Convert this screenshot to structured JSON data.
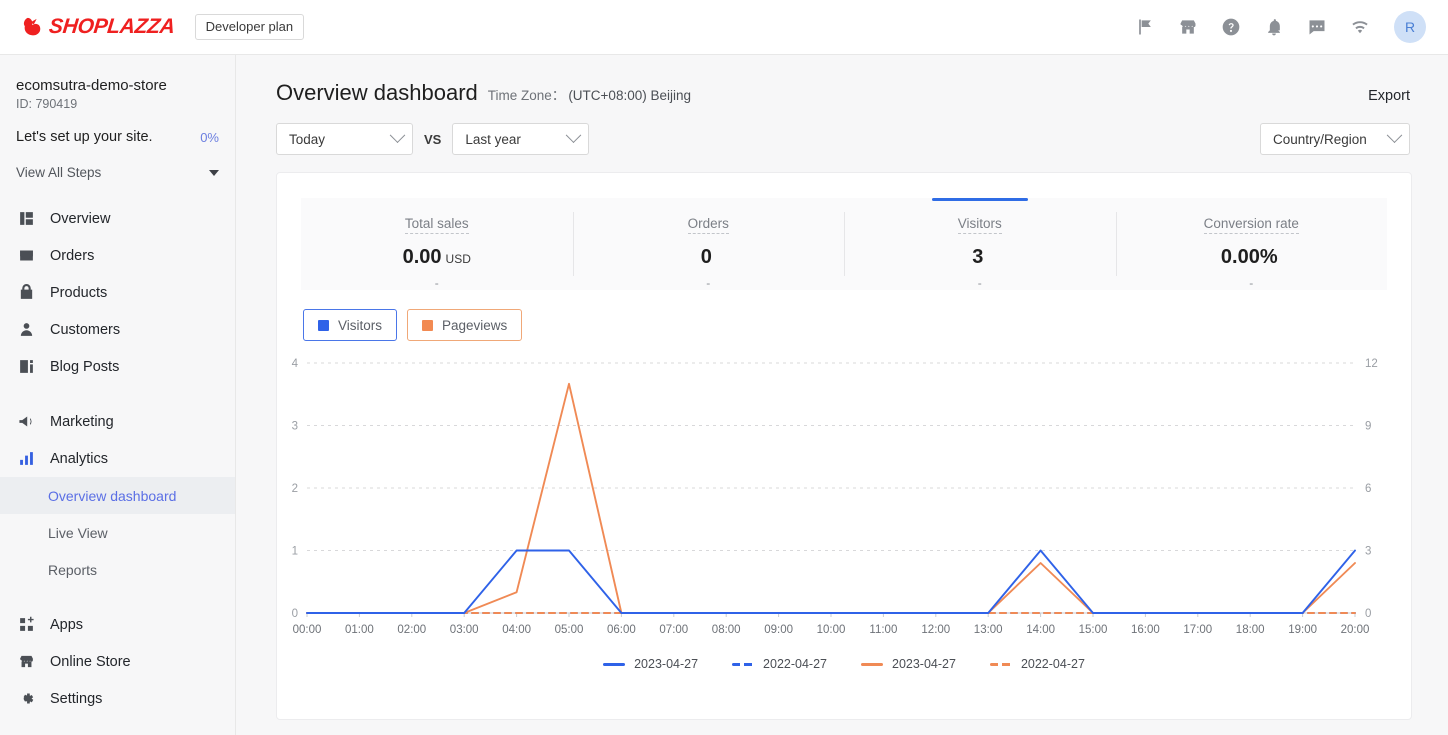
{
  "topbar": {
    "brand": "SHOPLAZZA",
    "plan_badge": "Developer plan",
    "icons": [
      "flag-icon",
      "store-icon",
      "help-icon",
      "bell-icon",
      "chat-icon",
      "wifi-icon"
    ],
    "avatar_initial": "R"
  },
  "sidebar": {
    "store_name": "ecomsutra-demo-store",
    "store_id": "ID: 790419",
    "setup_text": "Let's set up your site.",
    "setup_percent": "0%",
    "view_all_steps": "View All Steps",
    "nav_primary": [
      {
        "label": "Overview",
        "icon": "overview-icon"
      },
      {
        "label": "Orders",
        "icon": "orders-icon"
      },
      {
        "label": "Products",
        "icon": "products-icon"
      },
      {
        "label": "Customers",
        "icon": "customers-icon"
      },
      {
        "label": "Blog Posts",
        "icon": "blog-posts-icon"
      }
    ],
    "nav_secondary": [
      {
        "label": "Marketing",
        "icon": "marketing-icon"
      },
      {
        "label": "Analytics",
        "icon": "analytics-icon"
      }
    ],
    "nav_sub": [
      {
        "label": "Overview dashboard",
        "active": true
      },
      {
        "label": "Live View",
        "active": false
      },
      {
        "label": "Reports",
        "active": false
      }
    ],
    "nav_tertiary": [
      {
        "label": "Apps",
        "icon": "apps-icon"
      },
      {
        "label": "Online Store",
        "icon": "online-store-icon"
      },
      {
        "label": "Settings",
        "icon": "settings-icon"
      }
    ]
  },
  "header": {
    "title": "Overview dashboard",
    "timezone_label": "Time Zone：",
    "timezone_value": "(UTC+08:00) Beijing",
    "export_label": "Export"
  },
  "filters": {
    "range_primary": "Today",
    "vs_label": "VS",
    "range_compare": "Last year",
    "region": "Country/Region"
  },
  "metrics": [
    {
      "label": "Total sales",
      "value": "0.00",
      "unit": "USD",
      "delta": "-",
      "selected": false
    },
    {
      "label": "Orders",
      "value": "0",
      "unit": "",
      "delta": "-",
      "selected": false
    },
    {
      "label": "Visitors",
      "value": "3",
      "unit": "",
      "delta": "-",
      "selected": true
    },
    {
      "label": "Conversion rate",
      "value": "0.00%",
      "unit": "",
      "delta": "-",
      "selected": false
    }
  ],
  "chart_toggles": [
    {
      "label": "Visitors",
      "color": "#2f62e8",
      "active": true
    },
    {
      "label": "Pageviews",
      "color": "#f28a52",
      "active": true
    }
  ],
  "chart_data": {
    "type": "line",
    "title": "",
    "xlabel": "",
    "ylabel": "",
    "grid": true,
    "legend_position": "bottom",
    "x": [
      "00:00",
      "01:00",
      "02:00",
      "03:00",
      "04:00",
      "05:00",
      "06:00",
      "07:00",
      "08:00",
      "09:00",
      "10:00",
      "11:00",
      "12:00",
      "13:00",
      "14:00",
      "15:00",
      "16:00",
      "17:00",
      "18:00",
      "19:00",
      "20:00"
    ],
    "y_left_ticks": [
      0,
      1,
      2,
      3,
      4
    ],
    "y_right_ticks": [
      0,
      3,
      6,
      9,
      12
    ],
    "ylim_left": [
      0,
      4
    ],
    "ylim_right": [
      0,
      12
    ],
    "series": [
      {
        "name": "2023-04-27",
        "metric": "Visitors",
        "axis": "left",
        "color": "#2f62e8",
        "style": "solid",
        "values": [
          0,
          0,
          0,
          0,
          1,
          1,
          0,
          0,
          0,
          0,
          0,
          0,
          0,
          0,
          1,
          0,
          0,
          0,
          0,
          0,
          1
        ]
      },
      {
        "name": "2022-04-27",
        "metric": "Visitors",
        "axis": "left",
        "color": "#2f62e8",
        "style": "dashed",
        "values": [
          0,
          0,
          0,
          0,
          0,
          0,
          0,
          0,
          0,
          0,
          0,
          0,
          0,
          0,
          0,
          0,
          0,
          0,
          0,
          0,
          0
        ]
      },
      {
        "name": "2023-04-27",
        "metric": "Pageviews",
        "axis": "right",
        "color": "#f08a55",
        "style": "solid",
        "values": [
          0,
          0,
          0,
          0,
          1,
          11,
          0,
          0,
          0,
          0,
          0,
          0,
          0,
          0,
          2.4,
          0,
          0,
          0,
          0,
          0,
          2.4
        ]
      },
      {
        "name": "2022-04-27",
        "metric": "Pageviews",
        "axis": "right",
        "color": "#f08a55",
        "style": "dashed",
        "values": [
          0,
          0,
          0,
          0,
          0,
          0,
          0,
          0,
          0,
          0,
          0,
          0,
          0,
          0,
          0,
          0,
          0,
          0,
          0,
          0,
          0
        ]
      }
    ],
    "legend": [
      {
        "label": "2023-04-27",
        "color": "#2f62e8",
        "style": "solid"
      },
      {
        "label": "2022-04-27",
        "color": "#2f62e8",
        "style": "dashed"
      },
      {
        "label": "2023-04-27",
        "color": "#f08a55",
        "style": "solid"
      },
      {
        "label": "2022-04-27",
        "color": "#f08a55",
        "style": "dashed"
      }
    ]
  }
}
